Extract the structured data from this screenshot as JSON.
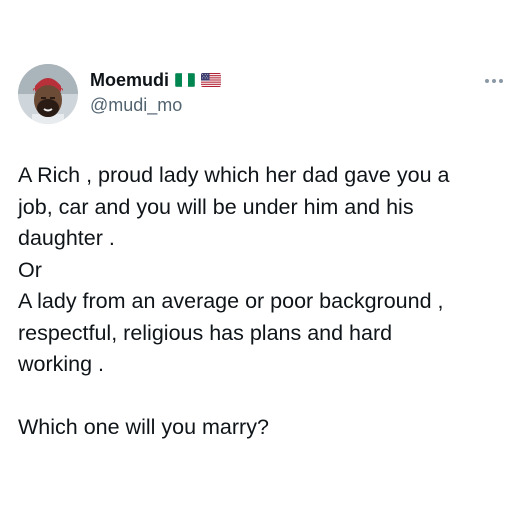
{
  "author": {
    "display_name": "Moemudi",
    "handle": "@mudi_mo",
    "flags": [
      "nigeria-flag-icon",
      "usa-flag-icon"
    ]
  },
  "menu_icon": "more-options-icon",
  "colors": {
    "text": "#0f1419",
    "secondary": "#536471",
    "nigeria_green": "#008751",
    "usa_red": "#b22234",
    "usa_blue": "#3c3b6e"
  },
  "tweet": {
    "lines": [
      "A Rich , proud lady which her dad gave you a",
      "job, car and you will be under him and his",
      "daughter .",
      "Or",
      "A lady from an average or poor background ,",
      "respectful, religious has plans and hard",
      "working .",
      "",
      "Which one will you marry?"
    ]
  }
}
